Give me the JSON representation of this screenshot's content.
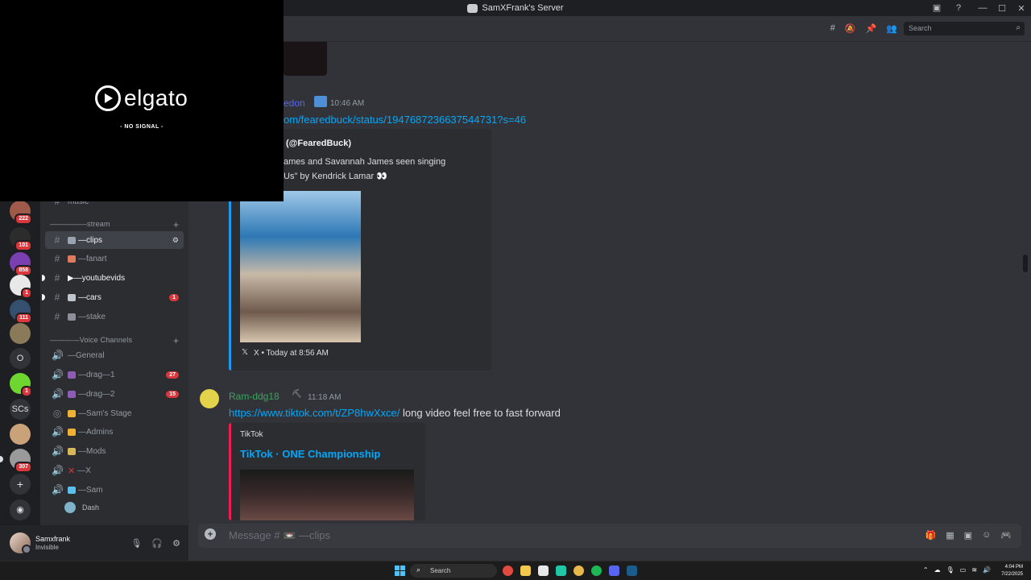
{
  "window": {
    "title": "SamXFrank's Server"
  },
  "overlay": {
    "brand": "elgato",
    "status": "- NO SIGNAL -"
  },
  "server_rail": {
    "badges": [
      "222",
      "101",
      "858",
      "1",
      "111",
      "1",
      "307"
    ],
    "text_servers": [
      "O",
      "SCs"
    ]
  },
  "sidebar": {
    "top_channel": "music",
    "categories": {
      "stream": "—————stream",
      "voice": "————Voice Channels"
    },
    "channels": [
      {
        "label": "—clips",
        "active": true
      },
      {
        "label": "—fanart"
      },
      {
        "label": "—youtubevids",
        "prefix": "▶"
      },
      {
        "label": "—cars",
        "badge": "1"
      },
      {
        "label": "—stake"
      }
    ],
    "voice_channels": [
      {
        "label": "—General"
      },
      {
        "label": "—drag—1",
        "badge": "27"
      },
      {
        "label": "—drag—2",
        "badge": "15"
      },
      {
        "label": "—Sam's Stage"
      },
      {
        "label": "—Admins"
      },
      {
        "label": "—Mods"
      },
      {
        "label": "—X"
      },
      {
        "label": "—Sam"
      }
    ],
    "voice_user": "Dash"
  },
  "user_panel": {
    "name": "Samxfrank",
    "status": "Invisible"
  },
  "header": {
    "search_placeholder": "Search"
  },
  "messages": [
    {
      "author": "edon",
      "time": "10:46 AM",
      "link": "om/fearedbuck/status/1947687236637544731?s=46",
      "embed": {
        "title": "(@FearedBuck)",
        "text_line1": "ames and Savannah James seen singing",
        "text_line2": "Us\" by Kendrick Lamar 👀",
        "footer": "X • Today at 8:56 AM"
      }
    },
    {
      "author": "Ram-ddg18",
      "time": "11:18 AM",
      "link": "https://www.tiktok.com/t/ZP8hwXxce/",
      "text": " long video feel free to fast forward",
      "embed": {
        "provider": "TikTok",
        "title": "TikTok · ONE Championship"
      }
    }
  ],
  "composer": {
    "placeholder": "Message # 📼 —clips"
  },
  "taskbar": {
    "search": "Search",
    "time": "4:04 PM",
    "date": "7/22/2025"
  },
  "colors": {
    "author_edon": "#5865f2",
    "author_ram": "#3ba55c",
    "embed_bar_x": "#1d9bf0",
    "embed_bar_tiktok": "#ee1d52",
    "badge_red": "#da373c"
  }
}
